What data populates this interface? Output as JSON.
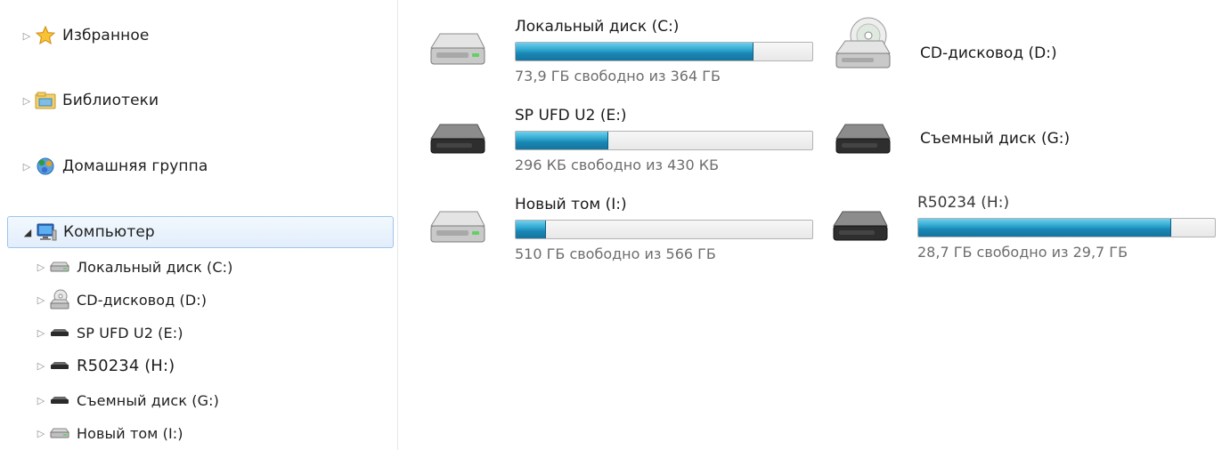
{
  "nav": {
    "items": [
      {
        "label": "Избранное",
        "icon": "star-icon",
        "expanded": false,
        "selected": false
      },
      {
        "label": "Библиотеки",
        "icon": "libraries-icon",
        "expanded": false,
        "selected": false
      },
      {
        "label": "Домашняя группа",
        "icon": "homegroup-icon",
        "expanded": false,
        "selected": false
      },
      {
        "label": "Компьютер",
        "icon": "computer-icon",
        "expanded": true,
        "selected": true
      }
    ],
    "computer_children": [
      {
        "label": "Локальный диск (C:)",
        "icon": "hard-drive-icon"
      },
      {
        "label": "CD-дисковод (D:)",
        "icon": "cd-drive-icon"
      },
      {
        "label": "SP UFD U2 (E:)",
        "icon": "usb-drive-icon"
      },
      {
        "label": "R50234 (H:)",
        "icon": "usb-drive-icon"
      },
      {
        "label": "Съемный диск (G:)",
        "icon": "usb-drive-icon"
      },
      {
        "label": "Новый том (I:)",
        "icon": "hard-drive-icon"
      }
    ]
  },
  "drives": [
    {
      "name": "Локальный диск (C:)",
      "free_text": "73,9 ГБ свободно из 364 ГБ",
      "used_fraction": 0.8,
      "icon": "hard-drive-icon"
    },
    {
      "name": "CD-дисковод (D:)",
      "free_text": "",
      "used_fraction": null,
      "icon": "cd-drive-icon"
    },
    {
      "name": "SP UFD U2 (E:)",
      "free_text": "296 КБ свободно из 430 КБ",
      "used_fraction": 0.31,
      "icon": "usb-drive-icon"
    },
    {
      "name": "Съемный диск (G:)",
      "free_text": "",
      "used_fraction": null,
      "icon": "usb-drive-icon"
    },
    {
      "name": "Новый том (I:)",
      "free_text": "510 ГБ свободно из 566 ГБ",
      "used_fraction": 0.1,
      "icon": "hard-drive-icon"
    },
    {
      "name": "R50234 (H:)",
      "free_text": "28,7 ГБ свободно из 29,7 ГБ",
      "used_fraction": 0.85,
      "icon": "usb-drive-icon"
    }
  ],
  "colors": {
    "bar_fill": "#1a86b3",
    "selection_border": "#9fc4ec",
    "free_text": "#6d6d6d"
  }
}
